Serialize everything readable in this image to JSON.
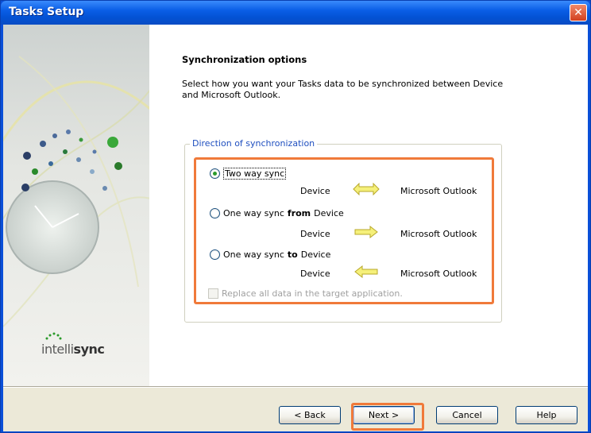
{
  "window": {
    "title": "Tasks Setup",
    "close_glyph": "✕"
  },
  "content": {
    "heading": "Synchronization options",
    "description": "Select how you want your Tasks data to be synchronized between Device and Microsoft Outlook.",
    "group_label": "Direction of synchronization",
    "options": [
      {
        "label": "Two way sync",
        "selected": true,
        "left": "Device",
        "right": "Microsoft Outlook",
        "arrow": "both"
      },
      {
        "label_prefix": "One way sync",
        "label_bold": "from",
        "label_suffix": "Device",
        "selected": false,
        "left": "Device",
        "right": "Microsoft Outlook",
        "arrow": "right"
      },
      {
        "label_prefix": "One way sync",
        "label_bold": "to",
        "label_suffix": "Device",
        "selected": false,
        "left": "Device",
        "right": "Microsoft Outlook",
        "arrow": "left"
      }
    ],
    "replace_label": "Replace all data in the target application.",
    "replace_checked": false,
    "replace_enabled": false
  },
  "sidebar": {
    "logo_prefix": "intelli",
    "logo_suffix": "sync"
  },
  "buttons": {
    "back": "< Back",
    "next": "Next >",
    "cancel": "Cancel",
    "help": "Help"
  },
  "colors": {
    "highlight": "#f07a3a",
    "arrow_fill": "#f5f07a",
    "arrow_stroke": "#b8a82a"
  }
}
